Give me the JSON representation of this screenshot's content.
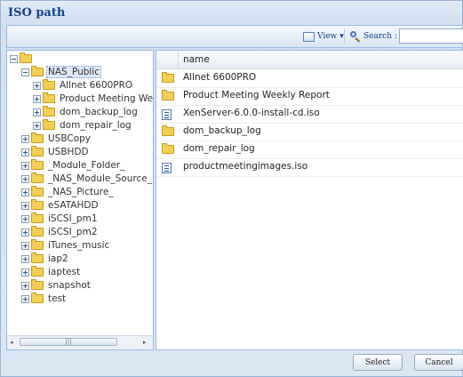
{
  "dialog": {
    "title": "ISO path"
  },
  "toolbar": {
    "view_label": "View",
    "view_arrow": "▾",
    "search_label": "Search :",
    "search_value": ""
  },
  "tree": {
    "root_icon": "folder-icon",
    "items": [
      {
        "label": "NAS_Public",
        "level": 1,
        "expander": "minus",
        "selected": true
      },
      {
        "label": "Allnet 6600PRO",
        "level": 2,
        "expander": "plus"
      },
      {
        "label": "Product Meeting We",
        "level": 2,
        "expander": "plus"
      },
      {
        "label": "dom_backup_log",
        "level": 2,
        "expander": "plus"
      },
      {
        "label": "dom_repair_log",
        "level": 2,
        "expander": "plus"
      },
      {
        "label": "USBCopy",
        "level": 1,
        "expander": "plus"
      },
      {
        "label": "USBHDD",
        "level": 1,
        "expander": "plus"
      },
      {
        "label": "_Module_Folder_",
        "level": 1,
        "expander": "plus"
      },
      {
        "label": "_NAS_Module_Source_",
        "level": 1,
        "expander": "plus"
      },
      {
        "label": "_NAS_Picture_",
        "level": 1,
        "expander": "plus"
      },
      {
        "label": "eSATAHDD",
        "level": 1,
        "expander": "plus"
      },
      {
        "label": "iSCSI_pm1",
        "level": 1,
        "expander": "plus"
      },
      {
        "label": "iSCSI_pm2",
        "level": 1,
        "expander": "plus"
      },
      {
        "label": "iTunes_music",
        "level": 1,
        "expander": "plus"
      },
      {
        "label": "iap2",
        "level": 1,
        "expander": "plus"
      },
      {
        "label": "iaptest",
        "level": 1,
        "expander": "plus"
      },
      {
        "label": "snapshot",
        "level": 1,
        "expander": "plus"
      },
      {
        "label": "test",
        "level": 1,
        "expander": "plus"
      }
    ],
    "scroll_thumb": "|||",
    "scroll_left": "◂",
    "scroll_right": "▸"
  },
  "list": {
    "column_name": "name",
    "rows": [
      {
        "name": "Allnet 6600PRO",
        "icon": "folder-icon"
      },
      {
        "name": "Product Meeting Weekly Report",
        "icon": "folder-icon"
      },
      {
        "name": "XenServer-6.0.0-install-cd.iso",
        "icon": "iso-file-icon"
      },
      {
        "name": "dom_backup_log",
        "icon": "folder-icon"
      },
      {
        "name": "dom_repair_log",
        "icon": "folder-icon"
      },
      {
        "name": "productmeetingimages.iso",
        "icon": "iso-file-icon"
      }
    ]
  },
  "footer": {
    "select_label": "Select",
    "cancel_label": "Cancel"
  }
}
